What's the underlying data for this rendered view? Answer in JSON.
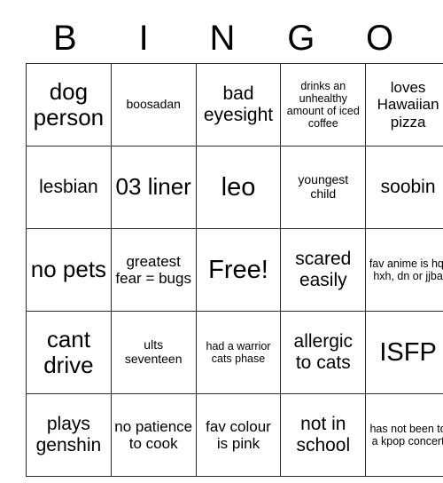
{
  "header": {
    "letters": [
      "B",
      "I",
      "N",
      "G",
      "O"
    ]
  },
  "grid": {
    "rows": [
      [
        {
          "text": "dog person",
          "size": "lg"
        },
        {
          "text": "boosadan",
          "size": "xs"
        },
        {
          "text": "bad eyesight",
          "size": "md"
        },
        {
          "text": "drinks an unhealthy amount of iced coffee",
          "size": "xxs"
        },
        {
          "text": "loves Hawaiian pizza",
          "size": "sm"
        }
      ],
      [
        {
          "text": "lesbian",
          "size": "md"
        },
        {
          "text": "03 liner",
          "size": "lg"
        },
        {
          "text": "leo",
          "size": "xl"
        },
        {
          "text": "youngest child",
          "size": "xs"
        },
        {
          "text": "soobin",
          "size": "md"
        }
      ],
      [
        {
          "text": "no pets",
          "size": "lg"
        },
        {
          "text": "greatest fear = bugs",
          "size": "sm"
        },
        {
          "text": "Free!",
          "size": "xl"
        },
        {
          "text": "scared easily",
          "size": "md"
        },
        {
          "text": "fav anime is hq, hxh, dn or jjba",
          "size": "xxs"
        }
      ],
      [
        {
          "text": "cant drive",
          "size": "lg"
        },
        {
          "text": "ults seventeen",
          "size": "xs"
        },
        {
          "text": "had a warrior cats phase",
          "size": "xxs"
        },
        {
          "text": "allergic to cats",
          "size": "md"
        },
        {
          "text": "ISFP",
          "size": "xl"
        }
      ],
      [
        {
          "text": "plays genshin",
          "size": "md"
        },
        {
          "text": "no patience to cook",
          "size": "sm"
        },
        {
          "text": "fav colour is pink",
          "size": "sm"
        },
        {
          "text": "not in school",
          "size": "md"
        },
        {
          "text": "has not been to a kpop concert",
          "size": "xxs"
        }
      ]
    ]
  },
  "colors": {
    "background": "#ffffff",
    "text": "#000000",
    "border": "#2b2b2b"
  }
}
